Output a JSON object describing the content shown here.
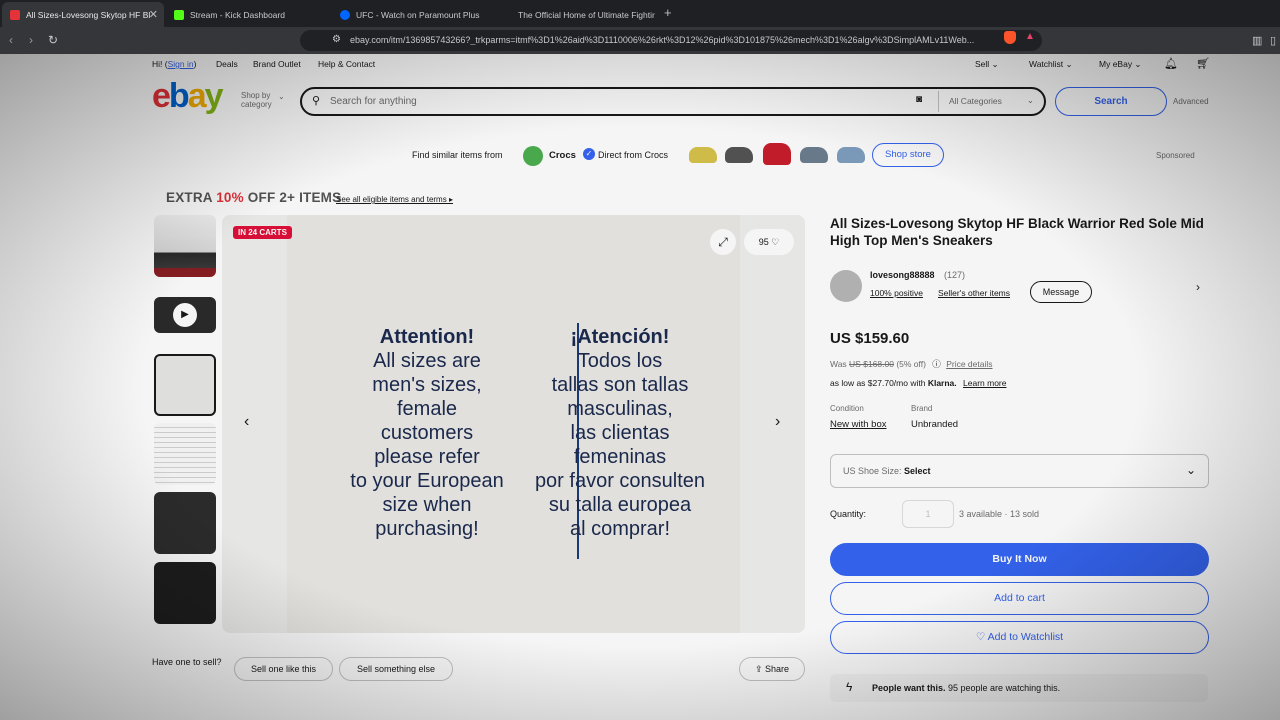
{
  "browser": {
    "tabs": [
      {
        "title": "All Sizes-Lovesong Skytop HF Bl",
        "favicon_color": "#e53238"
      },
      {
        "title": "Stream - Kick Dashboard",
        "favicon_color": "#53fc18"
      },
      {
        "title": "UFC - Watch on Paramount Plus",
        "favicon_color": "#0064ff"
      },
      {
        "title": "The Official Home of Ultimate Fightir",
        "favicon_color": "#d20a0a"
      }
    ],
    "url": "ebay.com/itm/136985743266?_trkparms=itmf%3D1%26aid%3D1110006%26rkt%3D12%26pid%3D101875%26mech%3D1%26algv%3DSimplAMLv11Web..."
  },
  "topnav": {
    "greeting": "Hi! (",
    "sign_in": "Sign in",
    "greeting_end": ")",
    "deals": "Deals",
    "brand_outlet": "Brand Outlet",
    "help": "Help & Contact",
    "sell": "Sell ⌄",
    "watchlist": "Watchlist ⌄",
    "my_ebay": "My eBay ⌄"
  },
  "header": {
    "logo": [
      "e",
      "b",
      "a",
      "y"
    ],
    "shop_by": "Shop by",
    "category": "category",
    "search_placeholder": "Search for anything",
    "category_select": "All Categories",
    "search_button": "Search",
    "advanced": "Advanced"
  },
  "similar": {
    "label": "Find similar items from",
    "brand": "Crocs",
    "direct": "Direct from Crocs",
    "shop_store": "Shop store",
    "sponsored": "Sponsored",
    "shoe_colors": [
      "#d8c34a",
      "#555555",
      "#c81e2b",
      "#6d7f90",
      "#7fa0c0"
    ]
  },
  "promo": {
    "prefix": "EXTRA ",
    "percent": "10%",
    "suffix": " OFF 2+ ITEMS",
    "link": "See all eligible items and terms ▸"
  },
  "gallery": {
    "badge": "IN 24 CARTS",
    "watch_count": "95",
    "left_col": {
      "heading": "Attention!",
      "lines": [
        "All sizes are",
        "men's sizes,",
        "female",
        "customers",
        "please refer",
        "to your European",
        "size when",
        "purchasing!"
      ]
    },
    "right_col": {
      "heading": "¡Atención!",
      "lines": [
        "Todos los",
        "tallas son tallas",
        "masculinas,",
        "las clientas",
        "femeninas",
        "por favor consulten",
        "su talla europea",
        "al comprar!"
      ]
    }
  },
  "sell": {
    "label": "Have one to sell?",
    "sell_one": "Sell one like this",
    "sell_else": "Sell something else",
    "share": "Share"
  },
  "product": {
    "title": "All Sizes-Lovesong Skytop HF Black Warrior Red Sole Mid High Top Men's Sneakers",
    "seller_name": "lovesong88888",
    "seller_count": "(127)",
    "positive": "100% positive",
    "other_items": "Seller's other items",
    "message": "Message",
    "price": "US $159.60",
    "was_label": "Was ",
    "was_price": "US $168.00",
    "discount": " (5% off)",
    "price_details": "Price details",
    "klarna_text": "as low as $27.70/mo with ",
    "klarna_brand": "Klarna.",
    "learn_more": "Learn more",
    "condition_label": "Condition",
    "condition_value": "New with box",
    "brand_label": "Brand",
    "brand_value": "Unbranded",
    "shoe_size_label": "US Shoe Size: ",
    "shoe_size_value": "Select",
    "quantity_label": "Quantity:",
    "quantity_value": "1",
    "availability": "3 available · 13 sold",
    "buy_now": "Buy It Now",
    "add_cart": "Add to cart",
    "add_watch": "♡ Add to Watchlist",
    "people_want": "People want this.",
    "watching_text": " 95 people are watching this."
  }
}
